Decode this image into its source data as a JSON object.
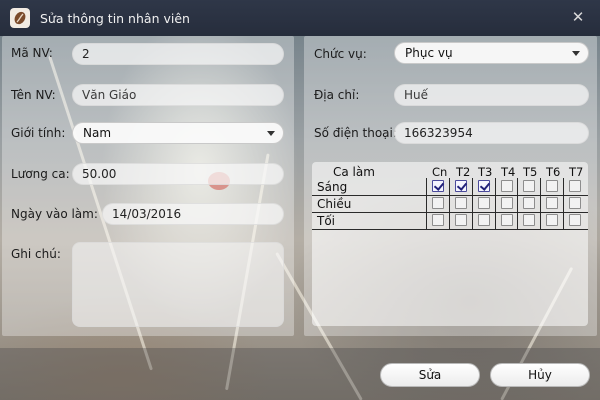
{
  "window": {
    "title": "Sửa thông tin nhân viên",
    "app_icon": "coffee-bean-icon",
    "close_glyph": "✕"
  },
  "form": {
    "ma_nv": {
      "label": "Mã NV:",
      "value": "2"
    },
    "ten_nv": {
      "label": "Tên NV:",
      "value": "Văn Giáo"
    },
    "gioi_tinh": {
      "label": "Giới tính:",
      "value": "Nam"
    },
    "luong_ca": {
      "label": "Lương ca:",
      "value": "50.00"
    },
    "ngay_vao_lam": {
      "label": "Ngày vào làm:",
      "value": "14/03/2016"
    },
    "ghi_chu": {
      "label": "Ghi chú:",
      "value": ""
    },
    "chuc_vu": {
      "label": "Chức vụ:",
      "value": "Phục vụ"
    },
    "dia_chi": {
      "label": "Địa chỉ:",
      "value": "Huế"
    },
    "so_dien_thoai": {
      "label": "Số điện thoại:",
      "value": "166323954"
    }
  },
  "schedule": {
    "header": "Ca làm",
    "days": [
      "Cn",
      "T2",
      "T3",
      "T4",
      "T5",
      "T6",
      "T7"
    ],
    "shifts": [
      {
        "label": "Sáng",
        "checked": [
          true,
          true,
          true,
          false,
          false,
          false,
          false
        ]
      },
      {
        "label": "Chiều",
        "checked": [
          false,
          false,
          false,
          false,
          false,
          false,
          false
        ]
      },
      {
        "label": "Tối",
        "checked": [
          false,
          false,
          false,
          false,
          false,
          false,
          false
        ]
      }
    ]
  },
  "buttons": {
    "save": "Sửa",
    "cancel": "Hủy"
  }
}
